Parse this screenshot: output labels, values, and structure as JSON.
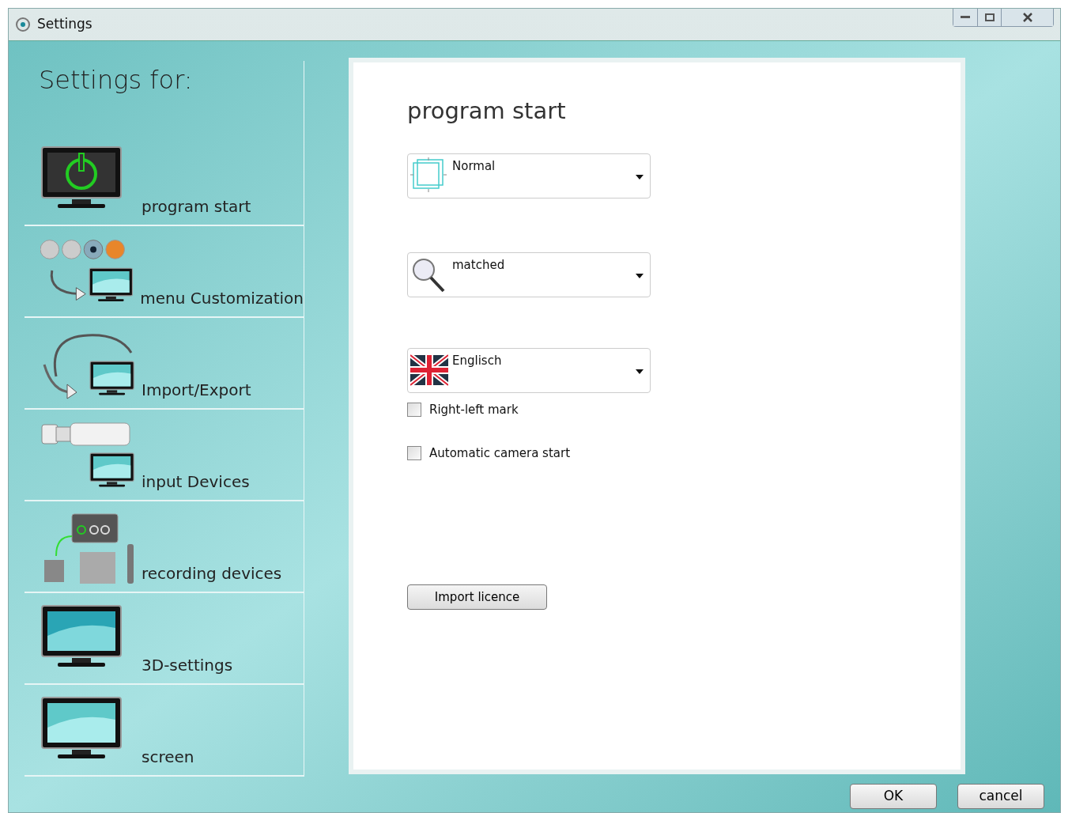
{
  "window": {
    "title": "Settings"
  },
  "sidebar": {
    "heading": "Settings for:",
    "items": [
      {
        "label": "program start"
      },
      {
        "label": "menu Customization"
      },
      {
        "label": "Import/Export"
      },
      {
        "label": "input Devices"
      },
      {
        "label": "recording devices"
      },
      {
        "label": "3D-settings"
      },
      {
        "label": "screen"
      }
    ]
  },
  "panel": {
    "title": "program start",
    "dropdowns": [
      {
        "value": "Normal"
      },
      {
        "value": "matched"
      },
      {
        "value": "Englisch"
      }
    ],
    "checkboxes": [
      {
        "label": "Right-left mark",
        "checked": false
      },
      {
        "label": "Automatic camera start",
        "checked": false
      }
    ],
    "button": "Import licence"
  },
  "buttons": [
    "OK",
    "cancel"
  ]
}
